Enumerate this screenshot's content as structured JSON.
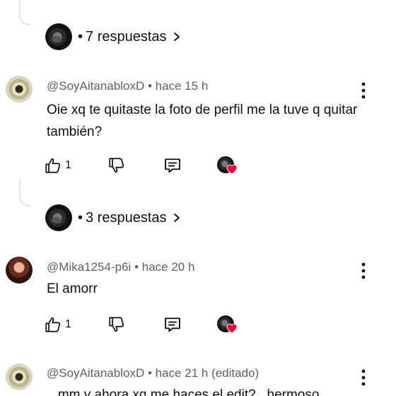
{
  "thread_1": {
    "replies_label": "7 respuestas",
    "separator": "•"
  },
  "comment_1": {
    "author": "@SoyAitanabloxD",
    "separator": "•",
    "time": "hace 15 h",
    "text": "Oie xq te quitaste la foto de perfil me la tuve q quitar también?",
    "likes": "1"
  },
  "thread_2": {
    "replies_label": "3 respuestas",
    "separator": "•"
  },
  "comment_2": {
    "author": "@Mika1254-p6i",
    "separator": "•",
    "time": "hace 20 h",
    "text": "El amorr",
    "likes": "1"
  },
  "comment_3": {
    "author": "@SoyAitanabloxD",
    "separator": "•",
    "time": "hace 21 h (editado)",
    "text": "...mm y ahora xq me haces el edit? , hermoso"
  },
  "colors": {
    "heart": "#ff0033",
    "meta": "#606060",
    "text": "#0f0f0f",
    "thread_line": "#e5e5e5"
  },
  "icons": [
    "like-icon",
    "dislike-icon",
    "reply-icon",
    "creator-heart-icon",
    "more-vert-icon",
    "chevron-right-icon"
  ]
}
